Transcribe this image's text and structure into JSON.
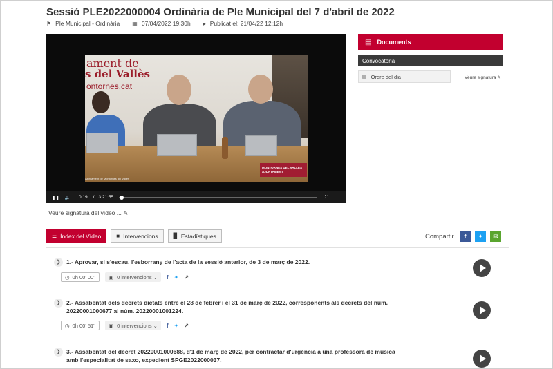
{
  "header": {
    "title": "Sessió PLE2022000004 Ordinària de Ple Municipal del 7 d'abril de 2022",
    "category": "Ple Municipal - Ordinària",
    "date": "07/04/2022 19:30h",
    "published": "Publicat el: 21/04/22 12:12h"
  },
  "video": {
    "scene_text_1": "ament de",
    "scene_text_2": "s del Vallès",
    "scene_text_3": "ontornes.cat",
    "badge_text": "MONTORNÈS DEL VALLÈS AJUNTAMENT",
    "caption": "Ajuntament de Montornès del Vallès",
    "current_time": "0:19",
    "separator": "/",
    "duration": "3:21:55",
    "progress_fraction": 0.0016,
    "signature_label": "Veure signatura del vídeo ..."
  },
  "sidebar": {
    "documents_label": "Documents",
    "convocatoria_label": "Convocatòria",
    "ordre_label": "Ordre del dia",
    "signature_label": "Veure signatura"
  },
  "tabs": {
    "index_label": "Índex del Vídeo",
    "interventions_label": "Intervencions",
    "stats_label": "Estadístiques",
    "share_label": "Compartir"
  },
  "colors": {
    "accent": "#c2002f",
    "facebook": "#3b5998",
    "twitter": "#1da1f2",
    "email": "#5aa52f"
  },
  "items": [
    {
      "title": "1.- Aprovar, si s'escau, l'esborrany de l'acta de la sessió anterior, de 3 de març de 2022.",
      "time": "0h 00' 00''",
      "interventions": "0 intervencions"
    },
    {
      "title": "2.- Assabentat dels decrets dictats entre el 28 de febrer i el 31 de març de 2022, corresponents als decrets del núm. 20220001000677 al núm. 20220001001224.",
      "time": "0h 00' 51''",
      "interventions": "0 intervencions"
    },
    {
      "title": "3.- Assabentat del decret 20220001000688, d'1 de març de 2022, per contractar d'urgència a una professora de música amb l'especialitat de saxo, expedient SPGE2022000037.",
      "time": "",
      "interventions": ""
    }
  ]
}
